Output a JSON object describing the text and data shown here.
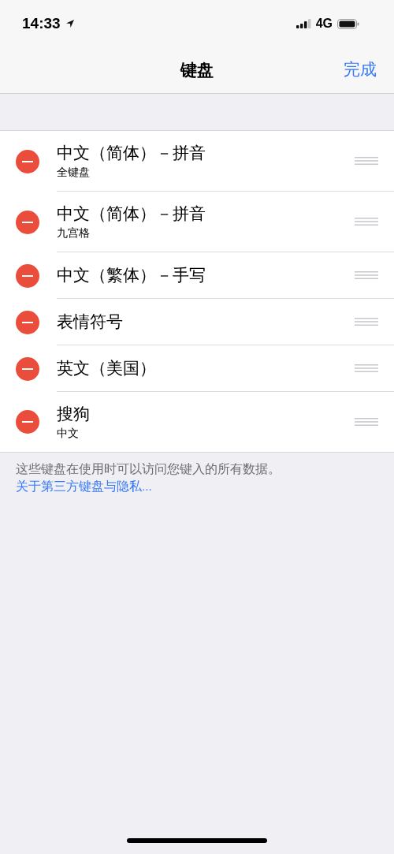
{
  "status_bar": {
    "time": "14:33",
    "network": "4G"
  },
  "nav": {
    "title": "键盘",
    "done": "完成"
  },
  "keyboards": [
    {
      "title": "中文（简体）－拼音",
      "subtitle": "全键盘"
    },
    {
      "title": "中文（简体）－拼音",
      "subtitle": "九宫格"
    },
    {
      "title": "中文（繁体）－手写"
    },
    {
      "title": "表情符号"
    },
    {
      "title": "英文（美国）"
    },
    {
      "title": "搜狗",
      "subtitle": "中文"
    }
  ],
  "footer": {
    "note": "这些键盘在使用时可以访问您键入的所有数据。",
    "link": "关于第三方键盘与隐私..."
  }
}
